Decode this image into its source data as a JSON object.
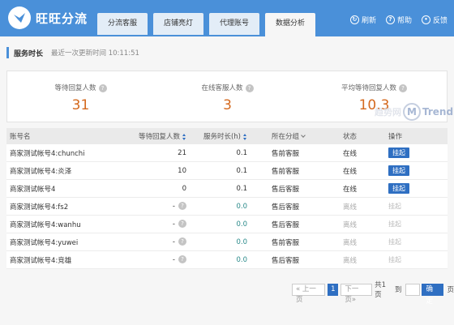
{
  "app": {
    "name": "旺旺分流"
  },
  "tabs": [
    {
      "label": "分流客服"
    },
    {
      "label": "店铺亮灯"
    },
    {
      "label": "代理账号"
    },
    {
      "label": "数据分析",
      "active": true
    }
  ],
  "toolbar": {
    "refresh": "刷新",
    "help": "帮助",
    "feedback": "反馈"
  },
  "section": {
    "title": "服务时长",
    "last_update": "最近一次更新时间 10:11:51"
  },
  "stats": [
    {
      "label": "等待回复人数",
      "value": "31"
    },
    {
      "label": "在线客服人数",
      "value": "3"
    },
    {
      "label": "平均等待回复人数",
      "value": "10.3"
    }
  ],
  "watermark": {
    "cn": "趋势网",
    "en": "Trend"
  },
  "table": {
    "headers": {
      "account": "账号名",
      "waiting": "等待回复人数",
      "duration": "服务时长(h)",
      "group": "所在分组",
      "status": "状态",
      "action": "操作"
    },
    "rows": [
      {
        "account": "商家测试帐号4:chunchi",
        "waiting": "21",
        "duration": "0.1",
        "group": "售前客服",
        "status": "在线",
        "action": "挂起"
      },
      {
        "account": "商家测试帐号4:炎泽",
        "waiting": "10",
        "duration": "0.1",
        "group": "售前客服",
        "status": "在线",
        "action": "挂起"
      },
      {
        "account": "商家测试帐号4",
        "waiting": "0",
        "duration": "0.1",
        "group": "售后客服",
        "status": "在线",
        "action": "挂起"
      },
      {
        "account": "商家测试帐号4:fs2",
        "waiting": "-",
        "duration": "0.0",
        "group": "售后客服",
        "status": "离线",
        "action": "挂起"
      },
      {
        "account": "商家测试帐号4:wanhu",
        "waiting": "-",
        "duration": "0.0",
        "group": "售后客服",
        "status": "离线",
        "action": "挂起"
      },
      {
        "account": "商家测试帐号4:yuwei",
        "waiting": "-",
        "duration": "0.0",
        "group": "售前客服",
        "status": "离线",
        "action": "挂起"
      },
      {
        "account": "商家测试帐号4:竞雄",
        "waiting": "-",
        "duration": "0.0",
        "group": "售后客服",
        "status": "离线",
        "action": "挂起"
      }
    ]
  },
  "pagination": {
    "prev": "« 上一页",
    "current": "1",
    "next": "下一页»",
    "total": "共1页",
    "goto": "到",
    "ok": "确定",
    "page_unit": "页"
  },
  "colors": {
    "header": "#4a90d9",
    "accent": "#d4691e",
    "primary_button": "#2f6fc2",
    "teal_text": "#2a8a8a"
  }
}
